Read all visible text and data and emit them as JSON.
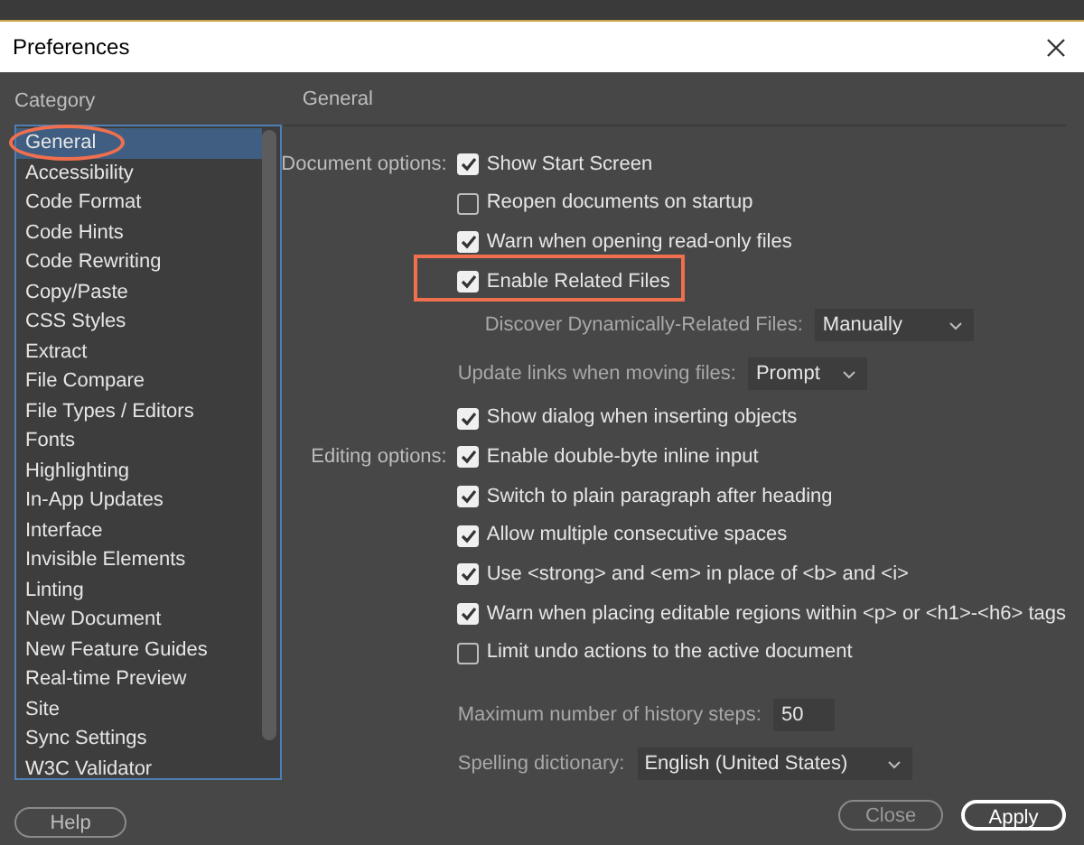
{
  "window": {
    "title": "Preferences"
  },
  "category": {
    "heading": "Category",
    "items": [
      {
        "label": "General",
        "selected": true,
        "annotated": true
      },
      {
        "label": "Accessibility",
        "selected": false,
        "annotated": false
      },
      {
        "label": "Code Format",
        "selected": false,
        "annotated": false
      },
      {
        "label": "Code Hints",
        "selected": false,
        "annotated": false
      },
      {
        "label": "Code Rewriting",
        "selected": false,
        "annotated": false
      },
      {
        "label": "Copy/Paste",
        "selected": false,
        "annotated": false
      },
      {
        "label": "CSS Styles",
        "selected": false,
        "annotated": false
      },
      {
        "label": "Extract",
        "selected": false,
        "annotated": false
      },
      {
        "label": "File Compare",
        "selected": false,
        "annotated": false
      },
      {
        "label": "File Types / Editors",
        "selected": false,
        "annotated": false
      },
      {
        "label": "Fonts",
        "selected": false,
        "annotated": false
      },
      {
        "label": "Highlighting",
        "selected": false,
        "annotated": false
      },
      {
        "label": "In-App Updates",
        "selected": false,
        "annotated": false
      },
      {
        "label": "Interface",
        "selected": false,
        "annotated": false
      },
      {
        "label": "Invisible Elements",
        "selected": false,
        "annotated": false
      },
      {
        "label": "Linting",
        "selected": false,
        "annotated": false
      },
      {
        "label": "New Document",
        "selected": false,
        "annotated": false
      },
      {
        "label": "New Feature Guides",
        "selected": false,
        "annotated": false
      },
      {
        "label": "Real-time Preview",
        "selected": false,
        "annotated": false
      },
      {
        "label": "Site",
        "selected": false,
        "annotated": false
      },
      {
        "label": "Sync Settings",
        "selected": false,
        "annotated": false
      },
      {
        "label": "W3C Validator",
        "selected": false,
        "annotated": false
      }
    ]
  },
  "panel": {
    "heading": "General",
    "options": [
      {
        "kind": "checkbox",
        "group": "Document options:",
        "text": "Show Start Screen",
        "checked": true,
        "annotated": false
      },
      {
        "kind": "checkbox",
        "text": "Reopen documents on startup",
        "checked": false,
        "annotated": false
      },
      {
        "kind": "checkbox",
        "text": "Warn when opening read-only files",
        "checked": true,
        "annotated": false
      },
      {
        "kind": "checkbox",
        "text": "Enable Related Files",
        "checked": true,
        "annotated": true
      },
      {
        "kind": "select",
        "text": "Discover Dynamically-Related Files:",
        "value": "Manually",
        "indented": true
      },
      {
        "kind": "select",
        "text": "Update links when moving files:",
        "value": "Prompt",
        "indented": false
      },
      {
        "kind": "checkbox",
        "text": "Show dialog when inserting objects",
        "checked": true,
        "annotated": false
      },
      {
        "kind": "checkbox",
        "group": "Editing options:",
        "text": "Enable double-byte inline input",
        "checked": true,
        "annotated": false
      },
      {
        "kind": "checkbox",
        "text": "Switch to plain paragraph after heading",
        "checked": true,
        "annotated": false
      },
      {
        "kind": "checkbox",
        "text": "Allow multiple consecutive spaces",
        "checked": true,
        "annotated": false
      },
      {
        "kind": "checkbox",
        "text": "Use <strong> and <em> in place of <b> and <i>",
        "checked": true,
        "annotated": false
      },
      {
        "kind": "checkbox",
        "text": "Warn when placing editable regions within <p> or <h1>-<h6> tags",
        "checked": true,
        "annotated": false
      },
      {
        "kind": "checkbox",
        "text": "Limit undo actions to the active document",
        "checked": false,
        "annotated": false
      },
      {
        "kind": "gap"
      },
      {
        "kind": "input",
        "text": "Maximum number of history steps:",
        "value": "50"
      },
      {
        "kind": "select",
        "text": "Spelling dictionary:",
        "value": "English (United States)",
        "indented": false
      }
    ]
  },
  "buttons": [
    {
      "label": "Help",
      "kind": "plain"
    },
    {
      "label": "Close",
      "kind": "plain"
    },
    {
      "label": "Apply",
      "kind": "default"
    }
  ]
}
